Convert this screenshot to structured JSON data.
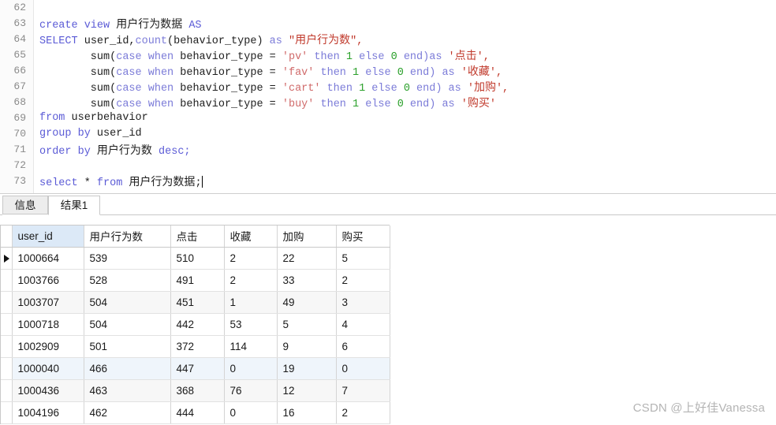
{
  "editor": {
    "lines": [
      {
        "number": "62",
        "segments": []
      },
      {
        "number": "63",
        "segments": [
          {
            "text": "create view ",
            "cls": "kw"
          },
          {
            "text": "用户行为数据",
            "cls": "cnblk"
          },
          {
            "text": " AS",
            "cls": "kw"
          }
        ]
      },
      {
        "number": "64",
        "segments": [
          {
            "text": "SELECT ",
            "cls": "kw"
          },
          {
            "text": "user_id,",
            "cls": "id"
          },
          {
            "text": "count",
            "cls": "kw2"
          },
          {
            "text": "(behavior_type) ",
            "cls": "id"
          },
          {
            "text": "as ",
            "cls": "kw2"
          },
          {
            "text": "\"",
            "cls": "dstr"
          },
          {
            "text": "用户行为数",
            "cls": "cn"
          },
          {
            "text": "\",",
            "cls": "dstr"
          }
        ]
      },
      {
        "number": "65",
        "segments": [
          {
            "text": "        sum",
            "cls": "id"
          },
          {
            "text": "(",
            "cls": "punct"
          },
          {
            "text": "case when ",
            "cls": "kw2"
          },
          {
            "text": "behavior_type = ",
            "cls": "id"
          },
          {
            "text": "'pv'",
            "cls": "str"
          },
          {
            "text": " then ",
            "cls": "kw2"
          },
          {
            "text": "1",
            "cls": "num"
          },
          {
            "text": " else ",
            "cls": "kw2"
          },
          {
            "text": "0",
            "cls": "num"
          },
          {
            "text": " end)",
            "cls": "kw2"
          },
          {
            "text": "as ",
            "cls": "kw2"
          },
          {
            "text": "'",
            "cls": "dstr"
          },
          {
            "text": "点击",
            "cls": "cn"
          },
          {
            "text": "',",
            "cls": "dstr"
          }
        ]
      },
      {
        "number": "66",
        "segments": [
          {
            "text": "        sum",
            "cls": "id"
          },
          {
            "text": "(",
            "cls": "punct"
          },
          {
            "text": "case when ",
            "cls": "kw2"
          },
          {
            "text": "behavior_type = ",
            "cls": "id"
          },
          {
            "text": "'fav'",
            "cls": "str"
          },
          {
            "text": " then ",
            "cls": "kw2"
          },
          {
            "text": "1",
            "cls": "num"
          },
          {
            "text": " else ",
            "cls": "kw2"
          },
          {
            "text": "0",
            "cls": "num"
          },
          {
            "text": " end) ",
            "cls": "kw2"
          },
          {
            "text": "as ",
            "cls": "kw2"
          },
          {
            "text": "'",
            "cls": "dstr"
          },
          {
            "text": "收藏",
            "cls": "cn"
          },
          {
            "text": "',",
            "cls": "dstr"
          }
        ]
      },
      {
        "number": "67",
        "segments": [
          {
            "text": "        sum",
            "cls": "id"
          },
          {
            "text": "(",
            "cls": "punct"
          },
          {
            "text": "case when ",
            "cls": "kw2"
          },
          {
            "text": "behavior_type = ",
            "cls": "id"
          },
          {
            "text": "'cart'",
            "cls": "str"
          },
          {
            "text": " then ",
            "cls": "kw2"
          },
          {
            "text": "1",
            "cls": "num"
          },
          {
            "text": " else ",
            "cls": "kw2"
          },
          {
            "text": "0",
            "cls": "num"
          },
          {
            "text": " end) ",
            "cls": "kw2"
          },
          {
            "text": "as ",
            "cls": "kw2"
          },
          {
            "text": "'",
            "cls": "dstr"
          },
          {
            "text": "加购",
            "cls": "cn"
          },
          {
            "text": "',",
            "cls": "dstr"
          }
        ]
      },
      {
        "number": "68",
        "segments": [
          {
            "text": "        sum",
            "cls": "id"
          },
          {
            "text": "(",
            "cls": "punct"
          },
          {
            "text": "case when ",
            "cls": "kw2"
          },
          {
            "text": "behavior_type = ",
            "cls": "id"
          },
          {
            "text": "'buy'",
            "cls": "str"
          },
          {
            "text": " then ",
            "cls": "kw2"
          },
          {
            "text": "1",
            "cls": "num"
          },
          {
            "text": " else ",
            "cls": "kw2"
          },
          {
            "text": "0",
            "cls": "num"
          },
          {
            "text": " end) ",
            "cls": "kw2"
          },
          {
            "text": "as ",
            "cls": "kw2"
          },
          {
            "text": "'",
            "cls": "dstr"
          },
          {
            "text": "购买",
            "cls": "cn"
          },
          {
            "text": "'",
            "cls": "dstr"
          }
        ]
      },
      {
        "number": "69",
        "segments": [
          {
            "text": "from ",
            "cls": "kw"
          },
          {
            "text": "userbehavior",
            "cls": "id"
          }
        ]
      },
      {
        "number": "70",
        "segments": [
          {
            "text": "group by ",
            "cls": "kw"
          },
          {
            "text": "user_id",
            "cls": "id"
          }
        ]
      },
      {
        "number": "71",
        "segments": [
          {
            "text": "order by ",
            "cls": "kw"
          },
          {
            "text": "用户行为数",
            "cls": "cnblk"
          },
          {
            "text": " desc;",
            "cls": "kw"
          }
        ]
      },
      {
        "number": "72",
        "segments": []
      },
      {
        "number": "73",
        "segments": [
          {
            "text": "select ",
            "cls": "kw"
          },
          {
            "text": "* ",
            "cls": "punct"
          },
          {
            "text": "from ",
            "cls": "kw"
          },
          {
            "text": "用户行为数据",
            "cls": "cnblk"
          },
          {
            "text": ";",
            "cls": "punct"
          }
        ],
        "caret": true
      }
    ]
  },
  "tabs": [
    {
      "label": "信息",
      "active": false
    },
    {
      "label": "结果1",
      "active": true
    }
  ],
  "result_grid": {
    "columns": [
      {
        "label": "user_id",
        "align": "left",
        "highlight": true
      },
      {
        "label": "用户行为数",
        "align": "right",
        "highlight": false
      },
      {
        "label": "点击",
        "align": "left",
        "highlight": false
      },
      {
        "label": "收藏",
        "align": "left",
        "highlight": false
      },
      {
        "label": "加购",
        "align": "left",
        "highlight": false
      },
      {
        "label": "购买",
        "align": "left",
        "highlight": false
      }
    ],
    "rows": [
      {
        "marker": true,
        "cells": [
          "1000664",
          "539",
          "510",
          "2",
          "22",
          "5"
        ]
      },
      {
        "marker": false,
        "cells": [
          "1003766",
          "528",
          "491",
          "2",
          "33",
          "2"
        ]
      },
      {
        "marker": false,
        "cells": [
          "1003707",
          "504",
          "451",
          "1",
          "49",
          "3"
        ]
      },
      {
        "marker": false,
        "cells": [
          "1000718",
          "504",
          "442",
          "53",
          "5",
          "4"
        ]
      },
      {
        "marker": false,
        "cells": [
          "1002909",
          "501",
          "372",
          "114",
          "9",
          "6"
        ]
      },
      {
        "marker": false,
        "cells": [
          "1000040",
          "466",
          "447",
          "0",
          "19",
          "0"
        ]
      },
      {
        "marker": false,
        "cells": [
          "1000436",
          "463",
          "368",
          "76",
          "12",
          "7"
        ]
      },
      {
        "marker": false,
        "cells": [
          "1004196",
          "462",
          "444",
          "0",
          "16",
          "2"
        ]
      }
    ]
  },
  "watermark": {
    "text": "CSDN @上好佳Vanessa"
  },
  "colors": {
    "keyword": "#5b5bd6",
    "string": "#d06a6a",
    "number": "#2aa02a",
    "header_highlight": "#dce9f7",
    "alt_row": "#f7f7f7",
    "alt_row2": "#eff5fb"
  }
}
